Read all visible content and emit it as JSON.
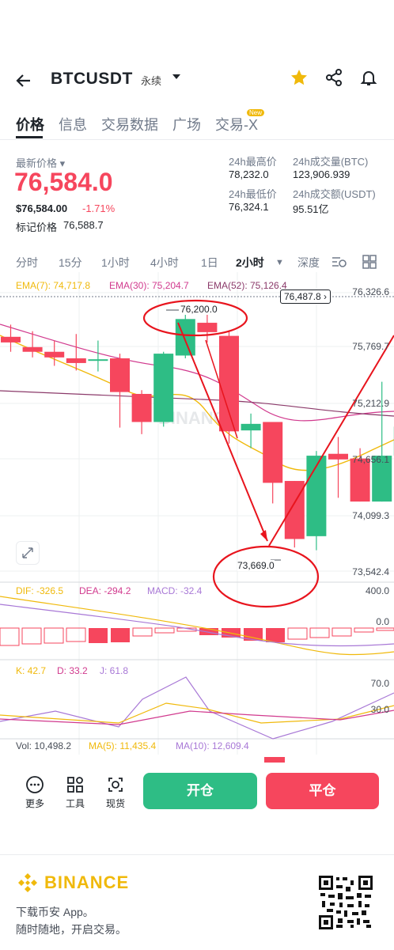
{
  "header": {
    "back_icon": "arrow-left-icon",
    "symbol": "BTCUSDT",
    "contract_type": "永续",
    "icons": [
      "star-icon",
      "share-icon",
      "bell-icon"
    ],
    "accent": "#f0b90b"
  },
  "tabs": [
    {
      "label": "价格",
      "active": true
    },
    {
      "label": "信息"
    },
    {
      "label": "交易数据"
    },
    {
      "label": "广场"
    },
    {
      "label": "交易-X",
      "badge": "New"
    }
  ],
  "ticker": {
    "last_price_label": "最新价格",
    "last_price": "76,584.0",
    "usd_price": "$76,584.00",
    "change_pct": "-1.71%",
    "mark_label": "标记价格",
    "mark_price": "76,588.7",
    "high_label": "24h最高价",
    "high": "78,232.0",
    "vol_btc_label": "24h成交量(BTC)",
    "vol_btc": "123,906.939",
    "low_label": "24h最低价",
    "low": "76,324.1",
    "vol_usdt_label": "24h成交额(USDT)",
    "vol_usdt": "95.51亿",
    "down_color": "#f6465d",
    "up_color": "#2ebd85"
  },
  "intervals": [
    {
      "label": "分时"
    },
    {
      "label": "15分"
    },
    {
      "label": "1小时"
    },
    {
      "label": "4小时"
    },
    {
      "label": "1日"
    },
    {
      "label": "2小时",
      "active": true
    },
    {
      "label": "深度"
    }
  ],
  "interval_icons": [
    "indicator-settings-icon",
    "grid-layout-icon"
  ],
  "ema": {
    "ema7": "EMA(7): 74,717.8",
    "ema30": "EMA(30): 75,204.7",
    "ema52": "EMA(52): 75,126.4"
  },
  "price_axis": [
    "76,326.6",
    "75,769.7",
    "75,212.9",
    "74,656.1",
    "74,099.3",
    "73,542.4"
  ],
  "current_price_tag": "76,487.8",
  "annotations": {
    "high": "76,200.0",
    "low": "73,669.0"
  },
  "watermark": "BINANCE",
  "macd": {
    "dif": "DIF: -326.5",
    "dea": "DEA: -294.2",
    "macd": "MACD: -32.4",
    "axis": [
      "400.0",
      "0.0"
    ]
  },
  "kdj": {
    "k": "K: 42.7",
    "d": "D: 33.2",
    "j": "J: 61.8",
    "axis": [
      "70.0",
      "30.0"
    ]
  },
  "volume": {
    "vol": "Vol: 10,498.2",
    "ma5": "MA(5): 11,435.4",
    "ma10": "MA(10): 12,609.4"
  },
  "bottom": {
    "tools": [
      {
        "label": "更多",
        "icon": "more-icon"
      },
      {
        "label": "工具",
        "icon": "tools-icon"
      },
      {
        "label": "现货",
        "icon": "spot-icon"
      }
    ],
    "open_label": "开仓",
    "close_label": "平仓"
  },
  "footer": {
    "brand": "BINANCE",
    "line1": "下载币安 App。",
    "line2": "随时随地，开启交易。",
    "qr_icon": "qr-code-icon"
  },
  "chart_data": {
    "type": "candlestick",
    "candles": [
      {
        "o": 75920,
        "h": 76050,
        "l": 75760,
        "c": 75860
      },
      {
        "o": 75810,
        "h": 75980,
        "l": 75700,
        "c": 75760
      },
      {
        "o": 75760,
        "h": 75880,
        "l": 75610,
        "c": 75700
      },
      {
        "o": 75690,
        "h": 75950,
        "l": 75560,
        "c": 75640
      },
      {
        "o": 75680,
        "h": 75880,
        "l": 75550,
        "c": 75680
      },
      {
        "o": 75690,
        "h": 75740,
        "l": 74950,
        "c": 75330
      },
      {
        "o": 75310,
        "h": 75350,
        "l": 74880,
        "c": 75010
      },
      {
        "o": 75010,
        "h": 75760,
        "l": 74960,
        "c": 75740
      },
      {
        "o": 75720,
        "h": 76200,
        "l": 75690,
        "c": 76110
      },
      {
        "o": 76070,
        "h": 76200,
        "l": 75860,
        "c": 75970
      },
      {
        "o": 75930,
        "h": 75990,
        "l": 74780,
        "c": 74910
      },
      {
        "o": 74920,
        "h": 75100,
        "l": 74730,
        "c": 74990
      },
      {
        "o": 75010,
        "h": 75010,
        "l": 74140,
        "c": 74360
      },
      {
        "o": 74380,
        "h": 74380,
        "l": 73669,
        "c": 73760
      },
      {
        "o": 73790,
        "h": 74700,
        "l": 73640,
        "c": 74650
      },
      {
        "o": 74670,
        "h": 74850,
        "l": 74200,
        "c": 74610
      },
      {
        "o": 74620,
        "h": 74730,
        "l": 74160,
        "c": 74160
      },
      {
        "o": 74160,
        "h": 75440,
        "l": 74160,
        "c": 74650
      },
      {
        "o": 74650,
        "h": 75200,
        "l": 74260,
        "c": 74960
      }
    ],
    "ylim": [
      73400,
      76400
    ]
  }
}
